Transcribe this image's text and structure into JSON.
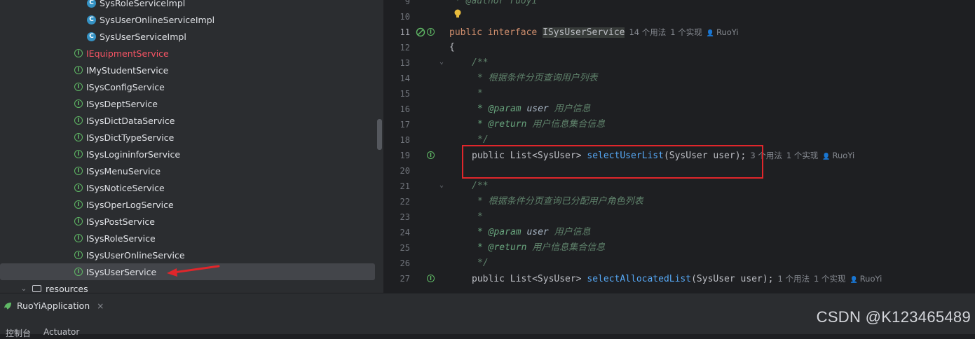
{
  "project_tree": {
    "items": [
      {
        "label": "SysRoleServiceImpl",
        "kind": "class"
      },
      {
        "label": "SysUserOnlineServiceImpl",
        "kind": "class"
      },
      {
        "label": "SysUserServiceImpl",
        "kind": "class"
      },
      {
        "label": "IEquipmentService",
        "kind": "interface"
      },
      {
        "label": "IMyStudentService",
        "kind": "interface"
      },
      {
        "label": "ISysConfigService",
        "kind": "interface"
      },
      {
        "label": "ISysDeptService",
        "kind": "interface"
      },
      {
        "label": "ISysDictDataService",
        "kind": "interface"
      },
      {
        "label": "ISysDictTypeService",
        "kind": "interface"
      },
      {
        "label": "ISysLogininforService",
        "kind": "interface"
      },
      {
        "label": "ISysMenuService",
        "kind": "interface"
      },
      {
        "label": "ISysNoticeService",
        "kind": "interface"
      },
      {
        "label": "ISysOperLogService",
        "kind": "interface"
      },
      {
        "label": "ISysPostService",
        "kind": "interface"
      },
      {
        "label": "ISysRoleService",
        "kind": "interface"
      },
      {
        "label": "ISysUserOnlineService",
        "kind": "interface"
      },
      {
        "label": "ISysUserService",
        "kind": "interface"
      },
      {
        "label": "resources",
        "kind": "folder"
      }
    ]
  },
  "editor": {
    "line_numbers": [
      "9",
      "10",
      "11",
      "12",
      "13",
      "14",
      "15",
      "16",
      "17",
      "18",
      "19",
      "20",
      "21",
      "22",
      "23",
      "24",
      "25",
      "26",
      "27"
    ],
    "author_tag": "* @author ruoyi",
    "kw_public": "public",
    "kw_interface": "interface",
    "interface_name": "ISysUserService",
    "interface_usages": "14 个用法",
    "interface_impls": "1 个实现",
    "author": "RuoYi",
    "open_brace": "{",
    "doc_open": "/**",
    "doc1": "* 根据条件分页查询用户列表",
    "doc_star": "*",
    "param_tag": "* @param",
    "param_name": "user",
    "param_desc": "用户信息",
    "return_tag": "* @return",
    "return_desc": "用户信息集合信息",
    "doc_close": "*/",
    "m1_prefix": "public List<SysUser> ",
    "m1_name": "selectUserList",
    "m1_suffix": "(SysUser user);",
    "m1_usages": "3 个用法",
    "m1_impls": "1 个实现",
    "doc2": "* 根据条件分页查询已分配用户角色列表",
    "m2_prefix": "public List<SysUser> ",
    "m2_name": "selectAllocatedList",
    "m2_suffix": "(SysUser user);",
    "m2_usages": "1 个用法",
    "m2_impls": "1 个实现"
  },
  "bottom": {
    "run_tab_label": "RuoYiApplication",
    "close_glyph": "×",
    "console_label": "控制台",
    "actuator_label": "Actuator"
  },
  "watermark": "CSDN @K123465489",
  "colors": {
    "annotation_box": "#e0262b",
    "arrow": "#e0262b"
  }
}
